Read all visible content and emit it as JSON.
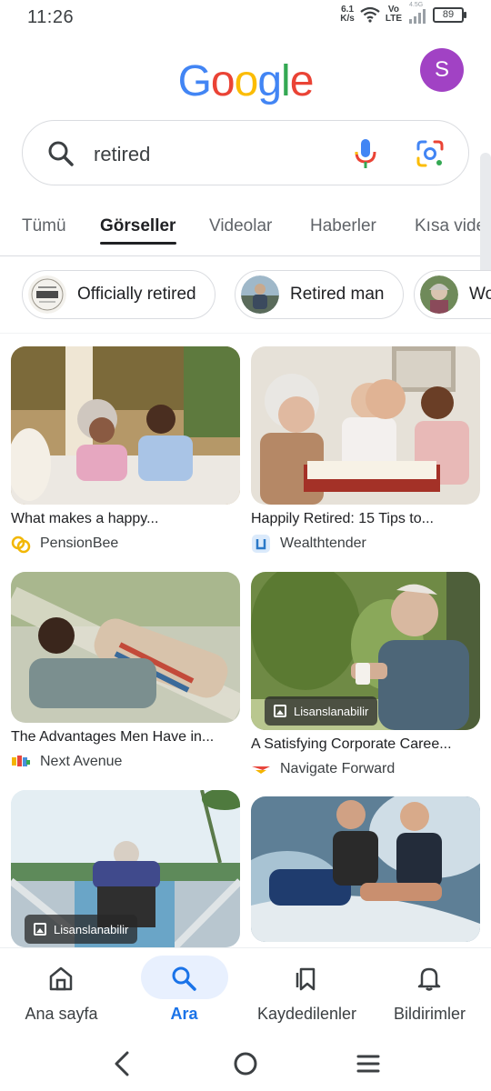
{
  "status_bar": {
    "time": "11:26",
    "speed_value": "6.1",
    "speed_unit": "K/s",
    "volte_top": "Vo",
    "volte_bottom": "LTE",
    "network": "4.5G",
    "battery": "89"
  },
  "header": {
    "logo_letters": [
      "G",
      "o",
      "o",
      "g",
      "l",
      "e"
    ],
    "logo_colors": [
      "#4285F4",
      "#EA4335",
      "#FBBC05",
      "#4285F4",
      "#34A853",
      "#EA4335"
    ],
    "avatar_letter": "S",
    "avatar_color": "#a142c4"
  },
  "search": {
    "query": "retired"
  },
  "tabs": [
    {
      "label": "Tümü",
      "active": false
    },
    {
      "label": "Görseller",
      "active": true
    },
    {
      "label": "Videolar",
      "active": false
    },
    {
      "label": "Haberler",
      "active": false
    },
    {
      "label": "Kısa vide",
      "active": false
    }
  ],
  "chips": [
    {
      "label": "Officially retired"
    },
    {
      "label": "Retired man"
    },
    {
      "label": "Wo"
    }
  ],
  "results": [
    {
      "title": "What makes a happy...",
      "source": "PensionBee",
      "licensable": false
    },
    {
      "title": "Happily Retired: 15 Tips to...",
      "source": "Wealthtender",
      "licensable": false
    },
    {
      "title": "The Advantages Men Have in...",
      "source": "Next Avenue",
      "licensable": false
    },
    {
      "title": "A Satisfying Corporate Caree...",
      "source": "Navigate Forward",
      "licensable": true,
      "license_label": "Lisanslanabilir"
    },
    {
      "title": "",
      "source": "",
      "licensable": true,
      "license_label": "Lisanslanabilir"
    },
    {
      "title": "",
      "source": "",
      "licensable": false
    }
  ],
  "bottom_nav": [
    {
      "label": "Ana sayfa",
      "icon": "home-icon",
      "active": false
    },
    {
      "label": "Ara",
      "icon": "search-icon",
      "active": true
    },
    {
      "label": "Kaydedilenler",
      "icon": "bookmarks-icon",
      "active": false
    },
    {
      "label": "Bildirimler",
      "icon": "bell-icon",
      "active": false
    }
  ],
  "colors": {
    "accent": "#1a73e8",
    "active_pill": "#e8f0fe"
  }
}
